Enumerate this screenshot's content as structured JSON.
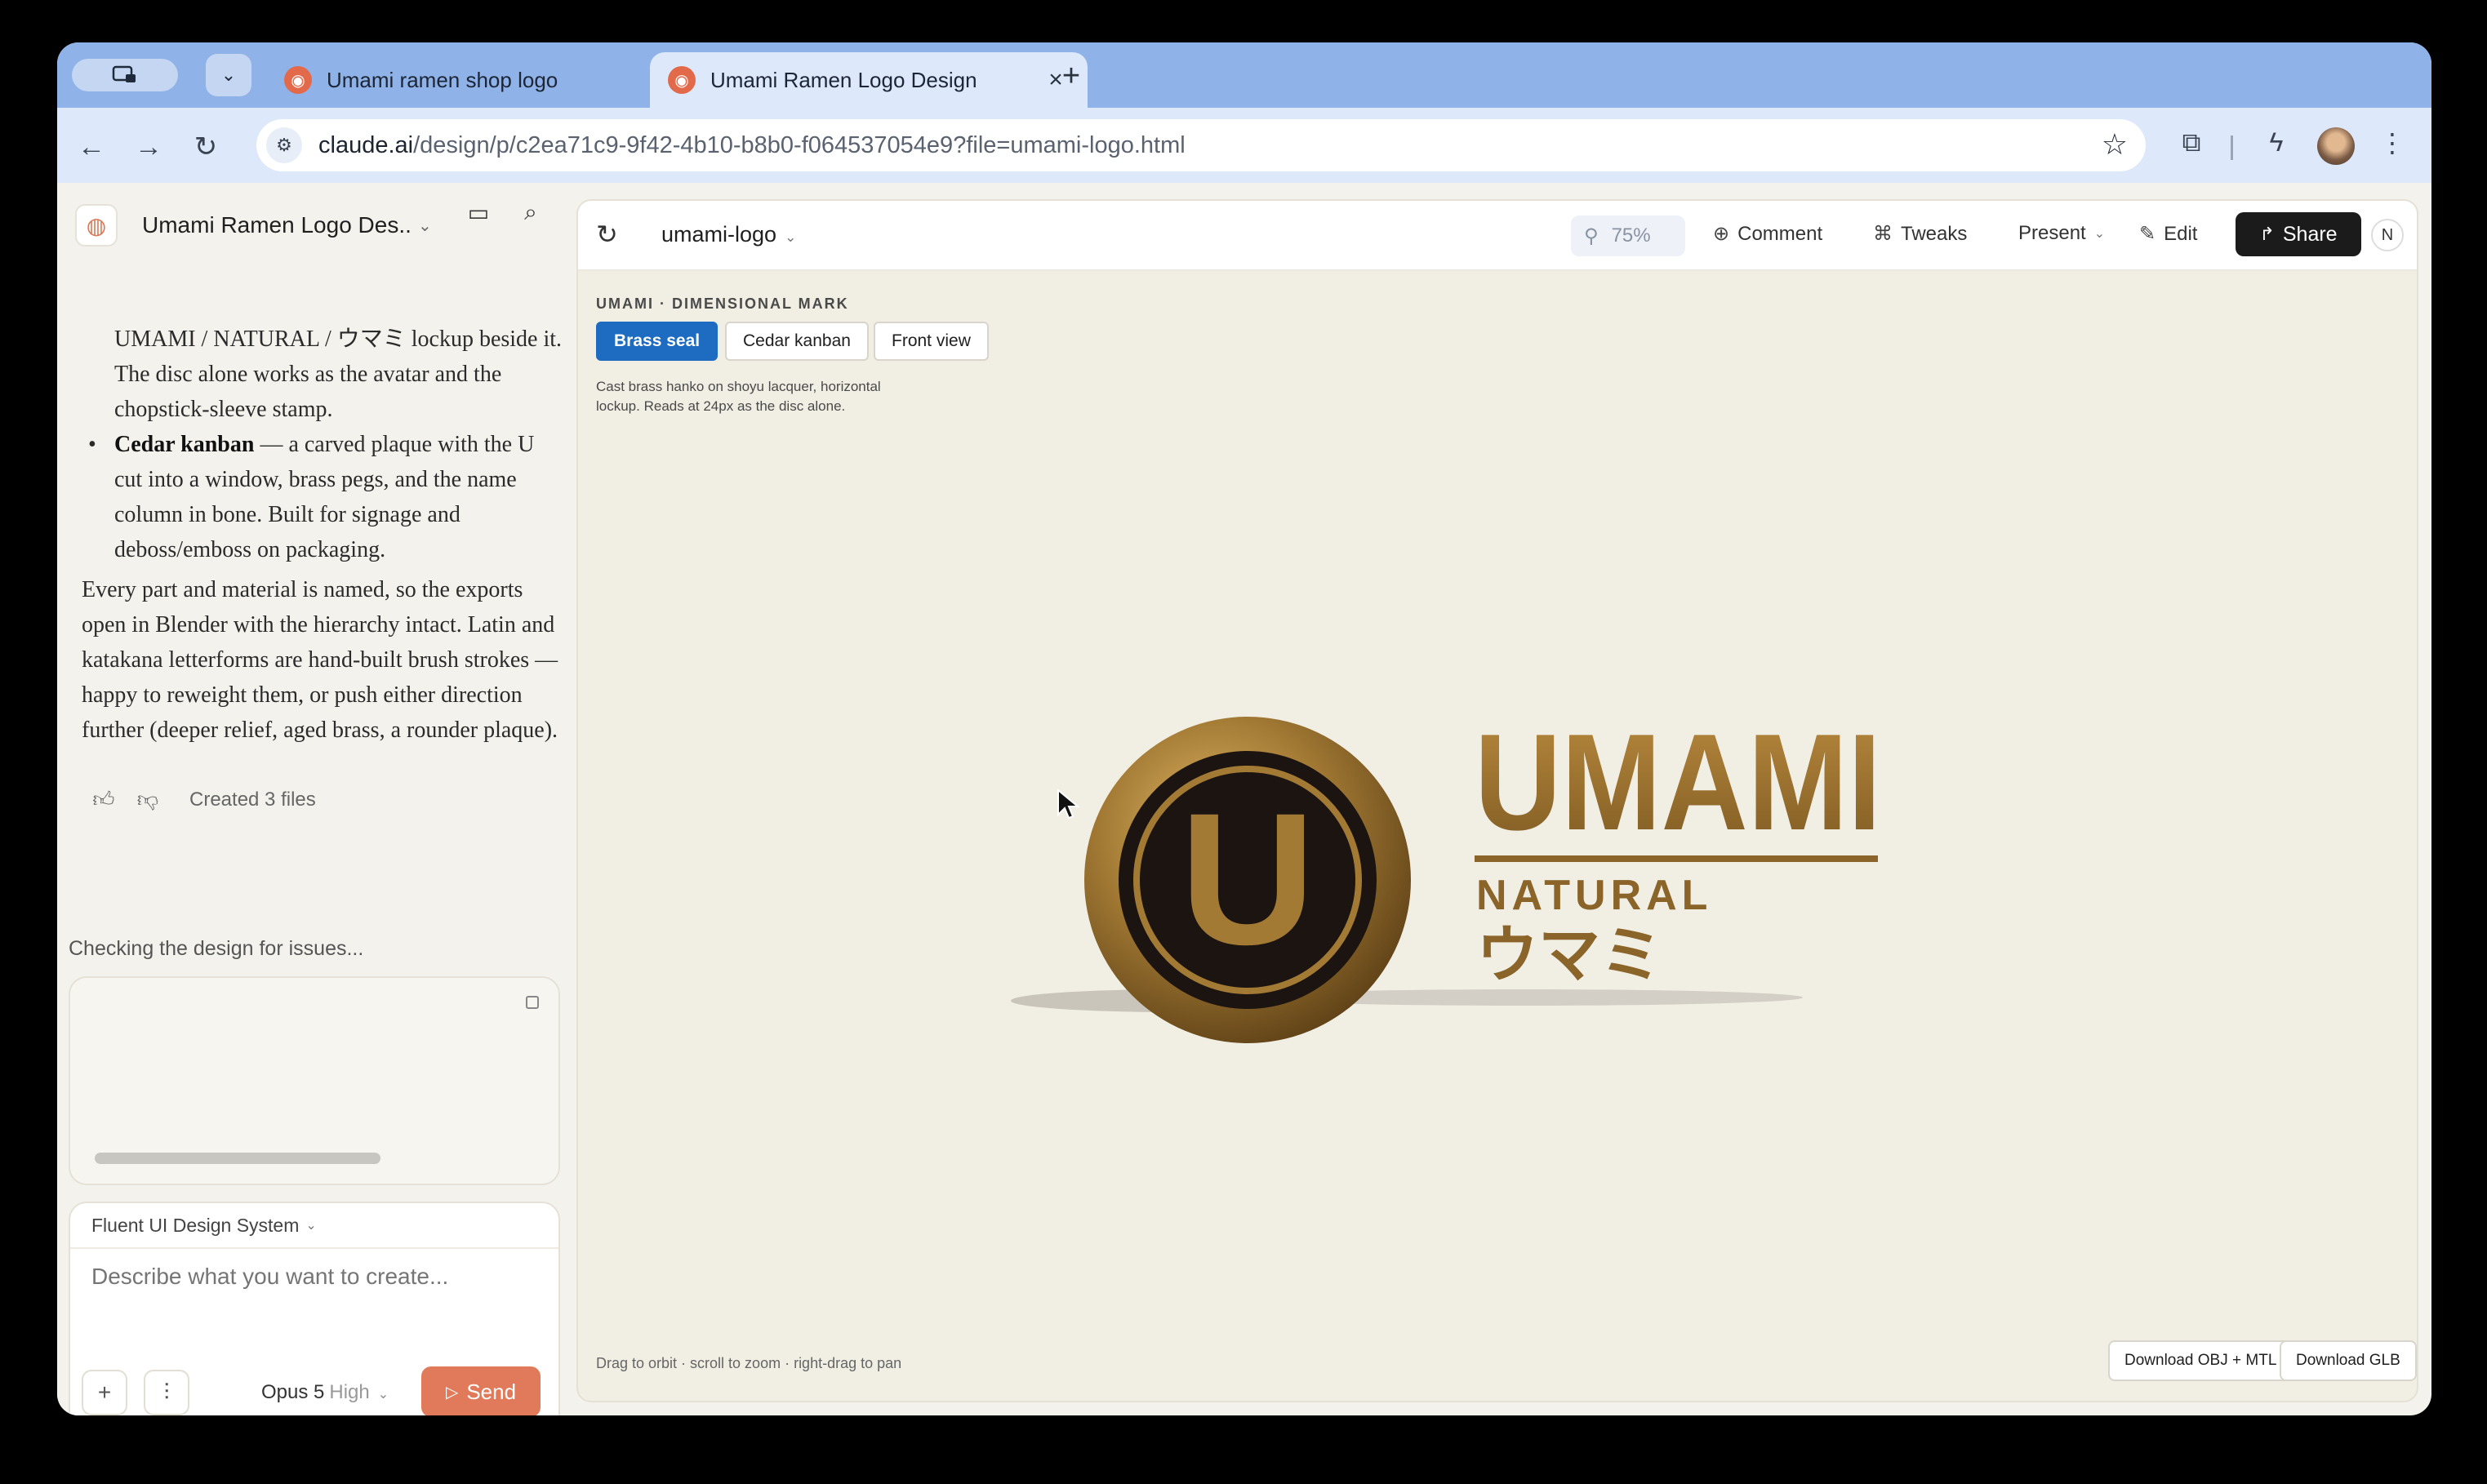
{
  "browser": {
    "tabs": [
      {
        "title": "Umami ramen shop logo",
        "active": false
      },
      {
        "title": "Umami Ramen Logo Design",
        "active": true
      }
    ],
    "url_domain": "claude.ai",
    "url_path": "/design/p/c2ea71c9-9f42-4b10-b8b0-f064537054e9?file=umami-logo.html"
  },
  "project": {
    "title": "Umami Ramen Logo Des..."
  },
  "chat": {
    "line_1": "UMAMI / NATURAL / ウマミ lockup beside it. The disc alone works as the avatar and the chopstick-sleeve stamp.",
    "bullet_bold": "Cedar kanban",
    "bullet_rest": " — a carved plaque with the U cut into a window, brass pegs, and the name column in bone. Built for signage and deboss/emboss on packaging.",
    "paragraph": "Every part and material is named, so the exports open in Blender with the hierarchy intact. Latin and katakana letterforms are hand-built brush strokes — happy to reweight them, or push either direction further (deeper relief, aged brass, a rounder plaque).",
    "created_files": "Created 3 files",
    "status": "Checking the design for issues..."
  },
  "composer": {
    "design_system": "Fluent UI Design System",
    "placeholder": "Describe what you want to create...",
    "model": "Opus 5",
    "effort": "High",
    "send_label": "Send"
  },
  "canvas": {
    "file_name": "umami-logo",
    "zoom": "75%",
    "actions": {
      "comment": "Comment",
      "tweaks": "Tweaks",
      "present": "Present",
      "edit": "Edit",
      "share": "Share"
    },
    "user_initial": "N",
    "kicker": "UMAMI · DIMENSIONAL MARK",
    "variants": [
      "Brass seal",
      "Cedar kanban",
      "Front view"
    ],
    "caption": "Cast brass hanko on shoyu lacquer, horizontal lockup. Reads at 24px as the disc alone.",
    "logo": {
      "seal_letter": "U",
      "wordmark": "UMAMI",
      "subline": "NATURAL",
      "katakana": "ウマミ"
    },
    "hint": "Drag to orbit · scroll to zoom · right-drag to pan",
    "download_obj": "Download OBJ + MTL",
    "download_glb": "Download GLB"
  },
  "colors": {
    "brass": "#a37a34",
    "lacquer": "#1c1410",
    "accent_blue": "#1d6cc2",
    "send_orange": "#e07a5a"
  }
}
